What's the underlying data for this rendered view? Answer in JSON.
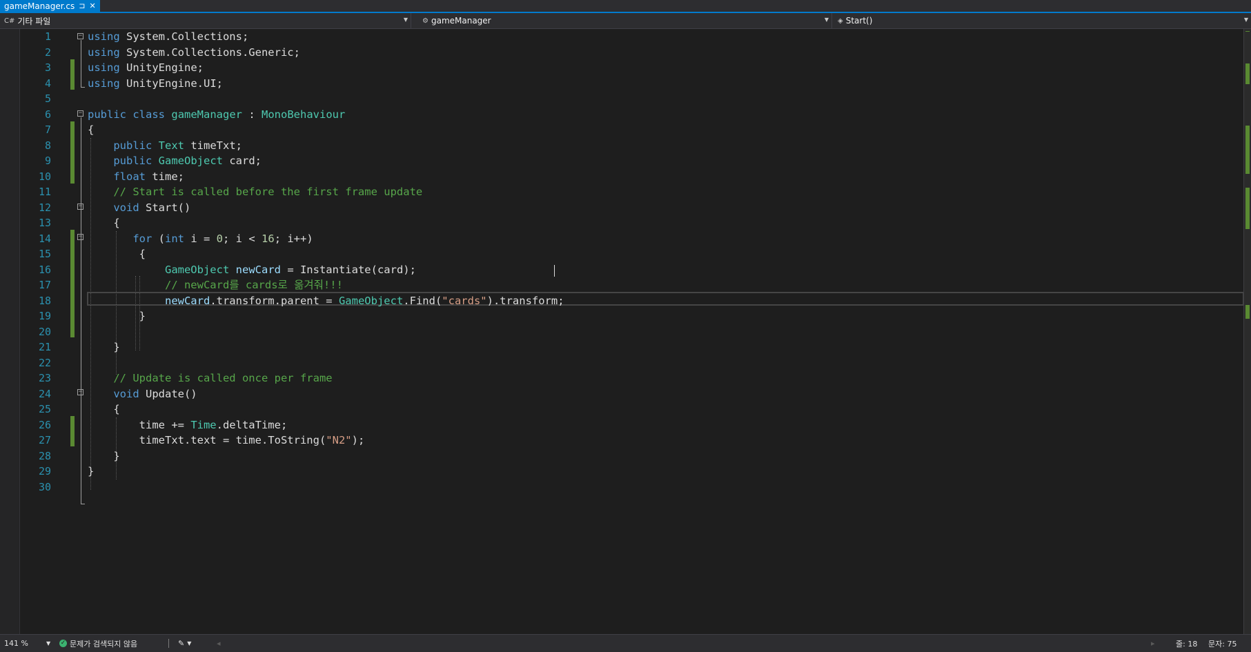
{
  "tab": {
    "filename": "gameManager.cs",
    "pin_glyph": "⊐",
    "close_glyph": "✕"
  },
  "navbar": {
    "project": "기타 파일",
    "class_name": "gameManager",
    "member": "Start()"
  },
  "editor": {
    "line_numbers": [
      "1",
      "2",
      "3",
      "4",
      "5",
      "6",
      "7",
      "8",
      "9",
      "10",
      "11",
      "12",
      "13",
      "14",
      "15",
      "16",
      "17",
      "18",
      "19",
      "20",
      "21",
      "22",
      "23",
      "24",
      "25",
      "26",
      "27",
      "28",
      "29",
      "30"
    ],
    "cursor_line": 18
  },
  "statusbar": {
    "zoom": "141 %",
    "issues": "문제가 검색되지 않음",
    "line": "줄: 18",
    "col": "문자: 75"
  },
  "colors": {
    "keyword": "#569cd6",
    "type": "#4ec9b0",
    "comment": "#57a64a",
    "string": "#d69d85",
    "change_bar": "#5a8a32",
    "accent": "#007acc"
  }
}
